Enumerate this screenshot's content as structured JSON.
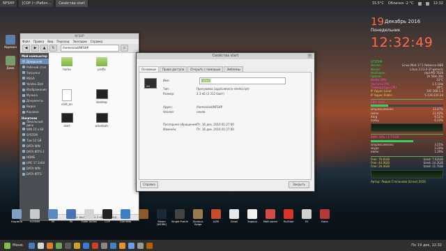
{
  "top_panel": {
    "tasks": [
      {
        "label": "NFSHP",
        "active": false
      },
      {
        "label": "[COP (~/Рабоч...",
        "active": false
      },
      {
        "label": "Свойства start",
        "active": true
      }
    ],
    "temperature": "33.5°C",
    "weather": "Облачно -2 °C",
    "time": "12:32"
  },
  "desktop_icons": [
    {
      "label": "Корзина",
      "color": "#5a7fa8"
    },
    {
      "label": "Дома",
      "color": "#7a9c6a"
    }
  ],
  "clock_widget": {
    "day": "19",
    "month_year": "Декабрь 2016",
    "weekday": "Понедельник",
    "time": "12:32:49"
  },
  "conky": {
    "header": "SYSTEM:",
    "info": [
      {
        "k": "Version:",
        "v": "Linux Mint 17.1 Rebecca i686"
      },
      {
        "k": "Kernel:",
        "v": "Linux 3.13.0-37-generic"
      },
      {
        "k": "Hostname:",
        "v": "vlad-MS-7636"
      },
      {
        "k": "Uptime:",
        "v": "2h 58m 39s"
      }
    ],
    "temps": [
      {
        "k": "Nvidia GPU",
        "v": "33°C"
      },
      {
        "k": "Частота CPU:",
        "v": "1.5 GHz"
      },
      {
        "k": "Температура CPU",
        "v": "39°C"
      }
    ],
    "net": [
      {
        "k": "IP Адрес Local:",
        "v": "192.168.1.3"
      },
      {
        "k": "IP Адрес Public:",
        "v": "5.139.220.34"
      }
    ],
    "cpu_title": "CPU: Intel",
    "cpu_procs": [
      {
        "k": "simplescreenrec",
        "v": "13.47%"
      },
      {
        "k": "nemo",
        "v": "11.62%"
      },
      {
        "k": "Xorg",
        "v": "9.51%"
      },
      {
        "k": "conky",
        "v": "6.23%"
      }
    ],
    "ram_title": "RAM: 59% / 1.77GiB",
    "ram_procs": [
      {
        "k": "simplescreenrec",
        "v": "3.25%"
      },
      {
        "k": "skype",
        "v": "3.20%"
      },
      {
        "k": "nemo",
        "v": "1.29%"
      }
    ],
    "disks": [
      {
        "k": "Free: 76.6GiB",
        "v": "Used: 7.62GiB"
      },
      {
        "k": "Free: 44.9GiB",
        "v": "Used: 14.3GiB"
      },
      {
        "k": "Free: 26.4GiB",
        "v": "Used: 11.7GiB"
      }
    ],
    "footer": "Автор: Лидия Степанова (Linux) 2016"
  },
  "file_manager": {
    "title": "NFSHP",
    "menu": [
      "Файл",
      "Правка",
      "Вид",
      "Переход",
      "Закладки",
      "Справка"
    ],
    "path": "/home/vlad/NFSHP",
    "sidebar": {
      "computer_header": "Мой компьютер",
      "computer_items": [
        "Домашняя",
        "Рабочий стол",
        "Загрузки",
        "MEGA",
        "Yandex.Disk",
        "Изображения",
        "Музыка",
        "Документы",
        "Видео",
        "Корзина"
      ],
      "drives_header": "Носители",
      "drive_items": [
        "Локальный диск",
        "WIN 10 x 64",
        "SYSTEM",
        "Том 52 GB",
        "DATA WIN",
        "DATA NTFS 2",
        "HOME",
        "LMC 17.2x64",
        "DATA WIN",
        "DATA NTFS"
      ]
    },
    "files": [
      {
        "label": "home",
        "kind": "folder"
      },
      {
        "label": "prefix",
        "kind": "folder"
      },
      {
        "label": "cont_an",
        "kind": "doc"
      },
      {
        "label": "desktop",
        "kind": "term"
      },
      {
        "label": "start",
        "kind": "term"
      },
      {
        "label": "winetools",
        "kind": "term"
      }
    ],
    "status": "«start» выделен (2,3 кБ), Свобод..."
  },
  "properties_dialog": {
    "title": "Свойства start",
    "tabs": [
      "Основные",
      "Права доступа",
      "Открыть с помощью",
      "Эмблемы"
    ],
    "name_label": "Имя:",
    "name_value": "start",
    "rows": [
      {
        "label": "Тип:",
        "value": "Программа (application/x-shellscript)"
      },
      {
        "label": "Размер:",
        "value": "2,3 кБ (2 312 байт)"
      },
      {
        "label": "Адрес:",
        "value": "/home/vlad/NFSHP"
      },
      {
        "label": "Volume:",
        "value": "неизв."
      },
      {
        "label": "Последнее обращение:",
        "value": "Пт. 16 дек. 2016 01:27:00"
      },
      {
        "label": "Изменён:",
        "value": "Пт. 16 дек. 2016 01:27:00"
      }
    ],
    "help_button": "Справка",
    "close_button": "Закрыть"
  },
  "dock": [
    {
      "label": "Корзина",
      "color": "#7da0c4"
    },
    {
      "label": "КОПИМ",
      "color": "#c9c9c9"
    },
    {
      "label": "5V",
      "color": "#5e88c2"
    },
    {
      "label": "5V",
      "color": "#4a73b3"
    },
    {
      "label": "Fuller Action",
      "color": "#d4d4d4"
    },
    {
      "label": "COP",
      "color": "#222222"
    },
    {
      "label": "Система",
      "color": "#3e7fc4"
    },
    {
      "label": "",
      "color": "#8b5a2b"
    },
    {
      "label": "Steam (WORK)",
      "color": "#1b2838"
    },
    {
      "label": "Single Prairie",
      "color": "#444444"
    },
    {
      "label": "Glorious Golgo",
      "color": "#9a7b4f"
    },
    {
      "label": "AZM",
      "color": "#c44d2a"
    },
    {
      "label": "Gmail",
      "color": "#e8e8e8"
    },
    {
      "label": "Задачи",
      "color": "#f0f0f0"
    },
    {
      "label": "Мой канал",
      "color": "#d44a4a"
    },
    {
      "label": "YouTube",
      "color": "#d9332b"
    },
    {
      "label": "5V",
      "color": "#cfcfcf"
    },
    {
      "label": "Кино",
      "color": "#b43a3a"
    }
  ],
  "bottom_panel": {
    "menu_label": "Меню",
    "panel_icons": [
      "#4b7bbf",
      "#d7d7d7",
      "#e07b2f",
      "#6aa84f",
      "#5a5a5a",
      "#c9a227",
      "#3c78d8",
      "#cc4125",
      "#888888",
      "#3d85c6",
      "#e69138",
      "#6d9eeb",
      "#999999",
      "#b45f06"
    ],
    "right_text": "Пн 19 дек, 12:32"
  }
}
